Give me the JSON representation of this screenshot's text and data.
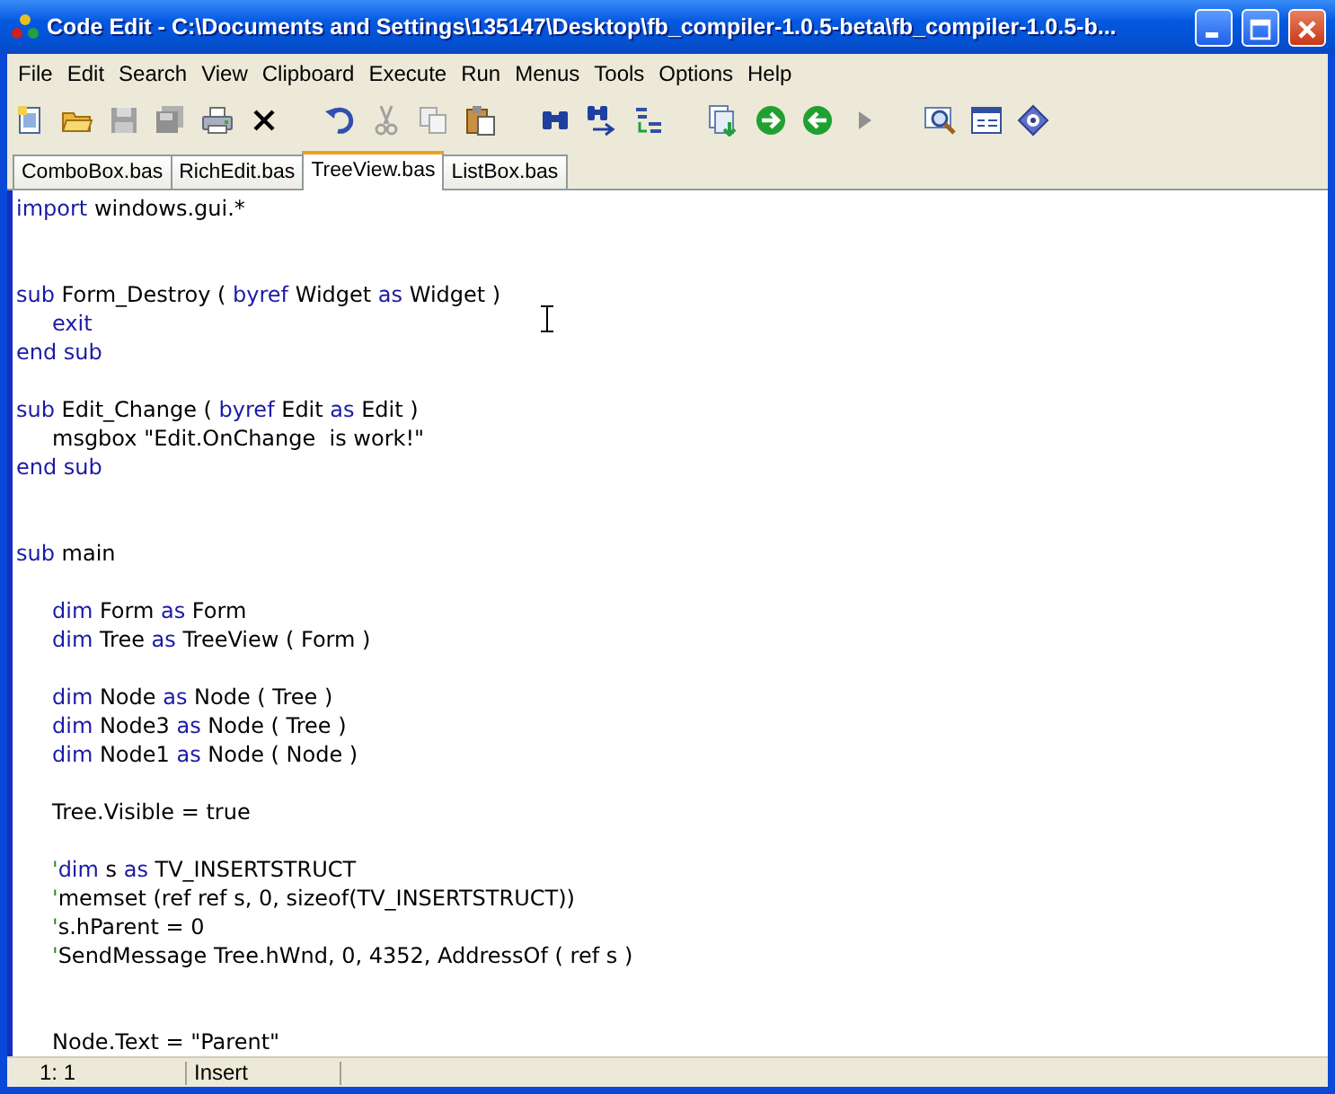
{
  "window": {
    "title": "Code Edit - C:\\Documents and Settings\\135147\\Desktop\\fb_compiler-1.0.5-beta\\fb_compiler-1.0.5-b..."
  },
  "menu": [
    "File",
    "Edit",
    "Search",
    "View",
    "Clipboard",
    "Execute",
    "Run",
    "Menus",
    "Tools",
    "Options",
    "Help"
  ],
  "tabs": [
    {
      "label": "ComboBox.bas",
      "selected": false
    },
    {
      "label": "RichEdit.bas",
      "selected": false
    },
    {
      "label": "TreeView.bas",
      "selected": true
    },
    {
      "label": "ListBox.bas",
      "selected": false
    }
  ],
  "editor": {
    "lines": [
      {
        "kind": "code",
        "indented": false,
        "tokens": [
          {
            "kind": "keyword",
            "text": "import"
          },
          {
            "kind": "plain",
            "text": " windows.gui.*"
          }
        ]
      },
      {
        "kind": "blank"
      },
      {
        "kind": "blank"
      },
      {
        "kind": "code",
        "indented": false,
        "tokens": [
          {
            "kind": "keyword",
            "text": "sub"
          },
          {
            "kind": "plain",
            "text": " Form_Destroy ( "
          },
          {
            "kind": "keyword",
            "text": "byref"
          },
          {
            "kind": "plain",
            "text": " Widget "
          },
          {
            "kind": "keyword",
            "text": "as"
          },
          {
            "kind": "plain",
            "text": " Widget )"
          }
        ]
      },
      {
        "kind": "code",
        "indented": true,
        "tokens": [
          {
            "kind": "keyword",
            "text": "exit"
          }
        ]
      },
      {
        "kind": "code",
        "indented": false,
        "tokens": [
          {
            "kind": "keyword",
            "text": "end sub"
          }
        ]
      },
      {
        "kind": "blank"
      },
      {
        "kind": "code",
        "indented": false,
        "tokens": [
          {
            "kind": "keyword",
            "text": "sub"
          },
          {
            "kind": "plain",
            "text": " Edit_Change ( "
          },
          {
            "kind": "keyword",
            "text": "byref"
          },
          {
            "kind": "plain",
            "text": " Edit "
          },
          {
            "kind": "keyword",
            "text": "as"
          },
          {
            "kind": "plain",
            "text": " Edit )"
          }
        ]
      },
      {
        "kind": "code",
        "indented": true,
        "tokens": [
          {
            "kind": "plain",
            "text": "msgbox \"Edit.OnChange  is work!\""
          }
        ]
      },
      {
        "kind": "code",
        "indented": false,
        "tokens": [
          {
            "kind": "keyword",
            "text": "end sub"
          }
        ]
      },
      {
        "kind": "blank"
      },
      {
        "kind": "blank"
      },
      {
        "kind": "code",
        "indented": false,
        "tokens": [
          {
            "kind": "keyword",
            "text": "sub"
          },
          {
            "kind": "plain",
            "text": " main"
          }
        ]
      },
      {
        "kind": "blank"
      },
      {
        "kind": "code",
        "indented": true,
        "tokens": [
          {
            "kind": "keyword",
            "text": "dim"
          },
          {
            "kind": "plain",
            "text": " Form "
          },
          {
            "kind": "keyword",
            "text": "as"
          },
          {
            "kind": "plain",
            "text": " Form"
          }
        ]
      },
      {
        "kind": "code",
        "indented": true,
        "tokens": [
          {
            "kind": "keyword",
            "text": "dim"
          },
          {
            "kind": "plain",
            "text": " Tree "
          },
          {
            "kind": "keyword",
            "text": "as"
          },
          {
            "kind": "plain",
            "text": " TreeView ( Form )"
          }
        ]
      },
      {
        "kind": "blank"
      },
      {
        "kind": "code",
        "indented": true,
        "tokens": [
          {
            "kind": "keyword",
            "text": "dim"
          },
          {
            "kind": "plain",
            "text": " Node "
          },
          {
            "kind": "keyword",
            "text": "as"
          },
          {
            "kind": "plain",
            "text": " Node ( Tree )"
          }
        ]
      },
      {
        "kind": "code",
        "indented": true,
        "tokens": [
          {
            "kind": "keyword",
            "text": "dim"
          },
          {
            "kind": "plain",
            "text": " Node3 "
          },
          {
            "kind": "keyword",
            "text": "as"
          },
          {
            "kind": "plain",
            "text": " Node ( Tree )"
          }
        ]
      },
      {
        "kind": "code",
        "indented": true,
        "tokens": [
          {
            "kind": "keyword",
            "text": "dim"
          },
          {
            "kind": "plain",
            "text": " Node1 "
          },
          {
            "kind": "keyword",
            "text": "as"
          },
          {
            "kind": "plain",
            "text": " Node ( Node )"
          }
        ]
      },
      {
        "kind": "blank"
      },
      {
        "kind": "code",
        "indented": true,
        "tokens": [
          {
            "kind": "plain",
            "text": "Tree.Visible = true"
          }
        ]
      },
      {
        "kind": "blank"
      },
      {
        "kind": "code",
        "indented": true,
        "tokens": [
          {
            "kind": "comment",
            "text": "'"
          },
          {
            "kind": "keyword",
            "text": "dim"
          },
          {
            "kind": "plain",
            "text": " s "
          },
          {
            "kind": "keyword",
            "text": "as"
          },
          {
            "kind": "plain",
            "text": " TV_INSERTSTRUCT"
          }
        ]
      },
      {
        "kind": "code",
        "indented": true,
        "tokens": [
          {
            "kind": "comment",
            "text": "'"
          },
          {
            "kind": "plain",
            "text": "memset (ref ref s, 0, sizeof(TV_INSERTSTRUCT))"
          }
        ]
      },
      {
        "kind": "code",
        "indented": true,
        "tokens": [
          {
            "kind": "comment",
            "text": "'"
          },
          {
            "kind": "plain",
            "text": "s.hParent = 0"
          }
        ]
      },
      {
        "kind": "code",
        "indented": true,
        "tokens": [
          {
            "kind": "comment",
            "text": "'"
          },
          {
            "kind": "plain",
            "text": "SendMessage Tree.hWnd, 0, 4352, AddressOf ( ref s )"
          }
        ]
      },
      {
        "kind": "blank"
      },
      {
        "kind": "blank"
      },
      {
        "kind": "code",
        "indented": true,
        "tokens": [
          {
            "kind": "plain",
            "text": "Node.Text = \"Parent\""
          }
        ]
      }
    ]
  },
  "status_bar": {
    "position": "1: 1",
    "mode": "Insert"
  }
}
